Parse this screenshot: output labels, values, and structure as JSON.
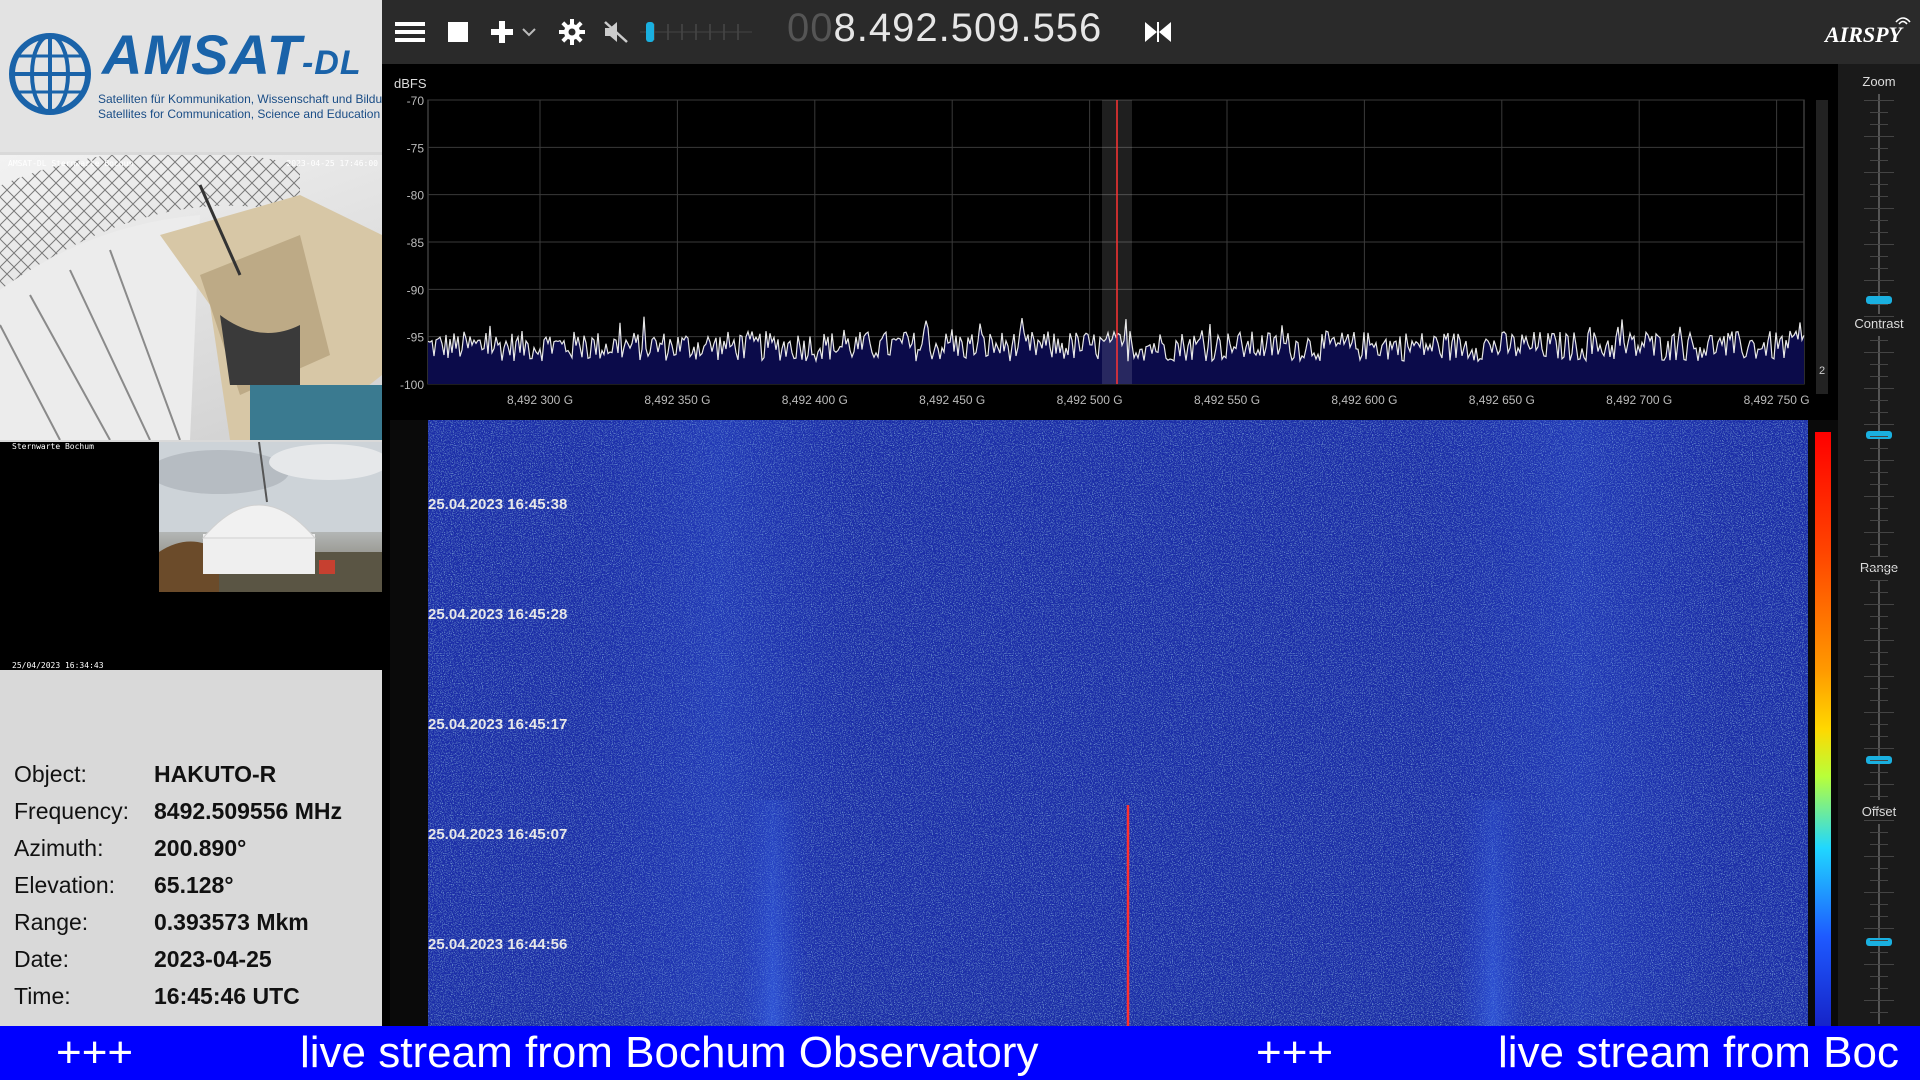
{
  "logo": {
    "brand": "AMSAT",
    "brand_suffix": "-DL",
    "tagline_de": "Satelliten für Kommunikation, Wissenschaft und Bildung",
    "tagline_en": "Satellites for Communication, Science and Education"
  },
  "cameras": {
    "cam1_label": "AMSAT-DL Sternwarte Bochum",
    "cam1_stamp": "2023-04-25 17:46:00",
    "cam2_label": "Sternwarte Bochum",
    "cam2_stamp": "25/04/2023 16:34:43"
  },
  "info": {
    "rows": [
      {
        "key": "Object:",
        "value": "HAKUTO-R"
      },
      {
        "key": "Frequency:",
        "value": "8492.509556 MHz"
      },
      {
        "key": "Azimuth:",
        "value": "200.890°"
      },
      {
        "key": "Elevation:",
        "value": "65.128°"
      },
      {
        "key": "Range:",
        "value": "0.393573 Mkm"
      },
      {
        "key": "Date:",
        "value": "2023-04-25"
      },
      {
        "key": "Time:",
        "value": "16:45:46 UTC"
      }
    ]
  },
  "toolbar": {
    "icons": [
      "menu-icon",
      "stop-icon",
      "add-icon",
      "chevron-down-icon",
      "settings-icon",
      "mute-icon",
      "volume-slider"
    ],
    "freq_dim": "00",
    "freq": "8.492.509.556",
    "swap_icon": "swap-icon",
    "brand": "AIRSPY"
  },
  "spectrum": {
    "yunit": "dBFS",
    "y_ticks": [
      "-70",
      "-75",
      "-80",
      "-85",
      "-90",
      "-95",
      "-100"
    ],
    "x_ticks": [
      "8,492 300 G",
      "8,492 350 G",
      "8,492 400 G",
      "8,492 450 G",
      "8,492 500 G",
      "8,492 550 G",
      "8,492 600 G",
      "8,492 650 G",
      "8,492 700 G",
      "8,492 750 G"
    ],
    "scroll_label": "2",
    "noise_floor_dbfs": -96,
    "colors": {
      "trace": "#e8e8e8",
      "fill": "#0b0b4a",
      "marker": "#ff3333",
      "grid": "#3a3a3a"
    }
  },
  "waterfall": {
    "timestamps": [
      "25.04.2023 16:45:38",
      "25.04.2023 16:45:28",
      "25.04.2023 16:45:17",
      "25.04.2023 16:45:07",
      "25.04.2023 16:44:56"
    ]
  },
  "sliders": {
    "zoom": "Zoom",
    "contrast": "Contrast",
    "range": "Range",
    "offset": "Offset"
  },
  "ticker": {
    "separator": "+++",
    "message": "live stream from Bochum Observatory",
    "message_partial": "live stream from Boc"
  }
}
